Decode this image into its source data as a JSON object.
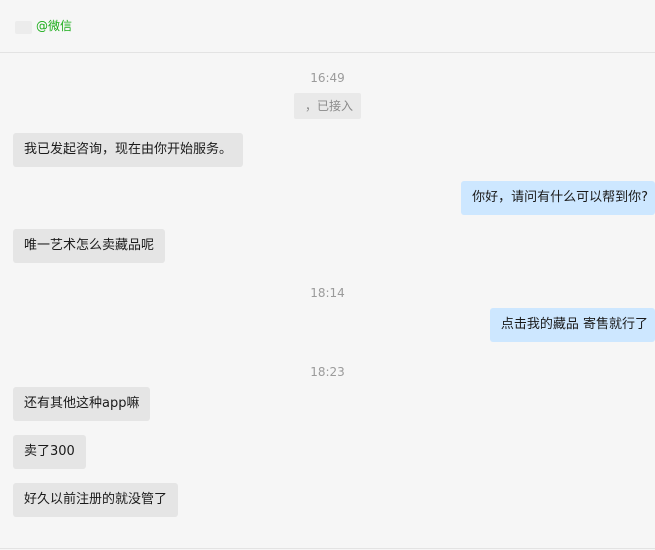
{
  "header": {
    "contact_name": "@微信"
  },
  "messages": {
    "ts1": "16:49",
    "system_notice": "，已接入",
    "m1": "我已发起咨询，现在由你开始服务。",
    "m2": "你好，请问有什么可以帮到你?",
    "m3": "唯一艺术怎么卖藏品呢",
    "ts2": "18:14",
    "m4": "点击我的藏品 寄售就行了",
    "ts3": "18:23",
    "m5": "还有其他这种app嘛",
    "m6": "卖了300",
    "m7": "好久以前注册的就没管了"
  },
  "colors": {
    "incoming_bubble": "#e5e5e5",
    "outgoing_bubble": "#cde7ff",
    "contact_name": "#1aad19",
    "background": "#f6f6f6"
  }
}
